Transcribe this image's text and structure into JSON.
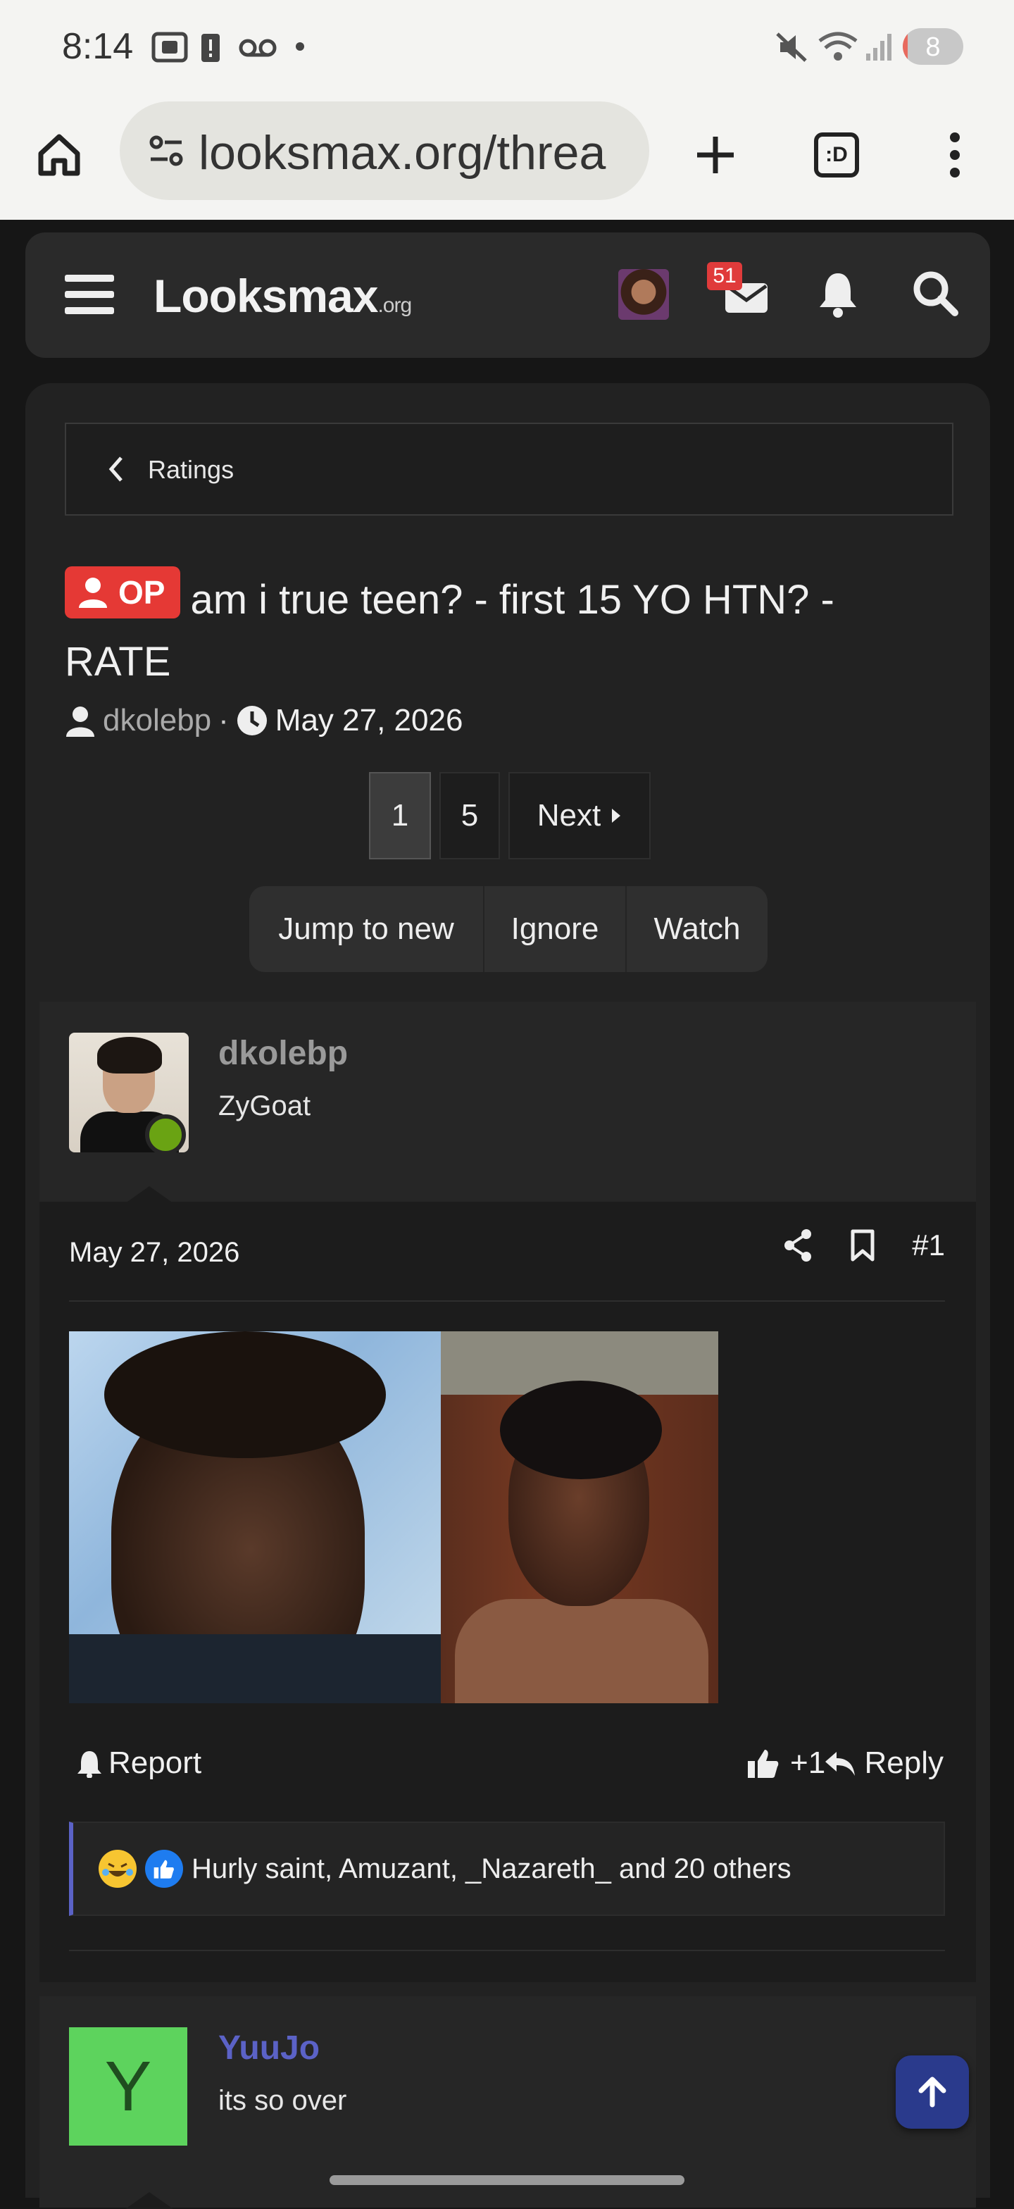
{
  "status_bar": {
    "time": "8:14",
    "battery": "8",
    "battery_level_pct": 8
  },
  "browser": {
    "url": "looksmax.org/threa",
    "tab_switcher_label": ":D"
  },
  "site": {
    "logo_main": "Looksmax",
    "logo_suffix": ".org",
    "inbox_count": "51"
  },
  "breadcrumb": {
    "label": "Ratings"
  },
  "thread": {
    "op_badge": "OP",
    "title": "am i true teen? - first 15 YO HTN? - RATE",
    "author": "dkolebp",
    "meta_sep": "·",
    "date": "May 27, 2026"
  },
  "pager": {
    "pages": [
      "1",
      "5"
    ],
    "next_label": "Next"
  },
  "actions": {
    "jump_label": "Jump to new",
    "ignore_label": "Ignore",
    "watch_label": "Watch"
  },
  "post1": {
    "username": "dkolebp",
    "user_title": "ZyGoat",
    "date": "May 27, 2026",
    "post_number": "#1",
    "report_label": "Report",
    "like_count": "+1",
    "reply_label": "Reply",
    "reactions_text": "Hurly saint, Amuzant, _Nazareth_ and 20 others"
  },
  "post2": {
    "avatar_letter": "Y",
    "username": "YuuJo",
    "text": "its so over"
  },
  "colors": {
    "accent": "#5b62c6",
    "op_badge": "#e53935",
    "online": "#6aa313"
  }
}
